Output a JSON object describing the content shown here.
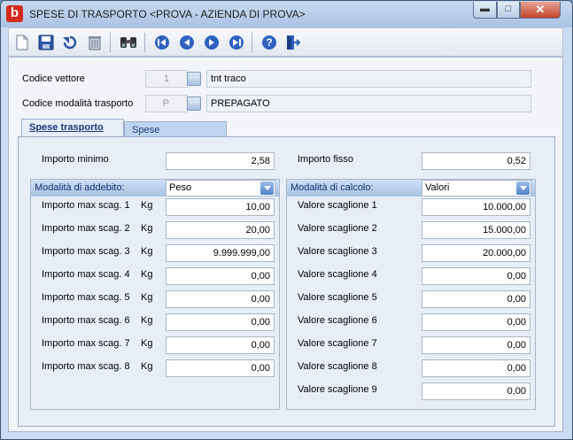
{
  "window": {
    "title": "SPESE DI TRASPORTO <PROVA - AZIENDA DI PROVA>",
    "app_icon_letter": "b",
    "min_glyph": "▬",
    "max_glyph": "□",
    "close_glyph": "✕"
  },
  "toolbar": {
    "buttons": [
      "new-document-icon",
      "save-icon",
      "undo-icon",
      "delete-icon",
      "find-icon",
      "first-record-icon",
      "previous-record-icon",
      "next-record-icon",
      "last-record-icon",
      "help-icon",
      "exit-icon"
    ]
  },
  "header": {
    "vettore_label": "Codice vettore",
    "vettore_code": "1",
    "vettore_desc": "tnt traco",
    "modalita_label": "Codice modalità trasporto",
    "modalita_code": "P",
    "modalita_desc": "PREPAGATO",
    "lookup_glyph": "···"
  },
  "tabs": [
    {
      "label": "Spese trasporto",
      "active": true
    },
    {
      "label": "Spese contrassegno",
      "active": false
    }
  ],
  "left": {
    "importo_minimo_label": "Importo minimo",
    "importo_minimo_value": "2,58",
    "group_label": "Modalità di addebito:",
    "combo_value": "Peso",
    "unit": "Kg",
    "rows": [
      {
        "label": "Importo max scag. 1",
        "value": "10,00"
      },
      {
        "label": "Importo max scag. 2",
        "value": "20,00"
      },
      {
        "label": "Importo max scag. 3",
        "value": "9.999.999,00"
      },
      {
        "label": "Importo max scag. 4",
        "value": "0,00"
      },
      {
        "label": "Importo max scag. 5",
        "value": "0,00"
      },
      {
        "label": "Importo max scag. 6",
        "value": "0,00"
      },
      {
        "label": "Importo max scag. 7",
        "value": "0,00"
      },
      {
        "label": "Importo max scag. 8",
        "value": "0,00"
      }
    ]
  },
  "right": {
    "importo_fisso_label": "Importo fisso",
    "importo_fisso_value": "0,52",
    "group_label": "Modalità di calcolo:",
    "combo_value": "Valori",
    "rows": [
      {
        "label": "Valore scaglione 1",
        "value": "10.000,00"
      },
      {
        "label": "Valore scaglione 2",
        "value": "15.000,00"
      },
      {
        "label": "Valore scaglione 3",
        "value": "20.000,00"
      },
      {
        "label": "Valore scaglione 4",
        "value": "0,00"
      },
      {
        "label": "Valore scaglione 5",
        "value": "0,00"
      },
      {
        "label": "Valore scaglione 6",
        "value": "0,00"
      },
      {
        "label": "Valore scaglione 7",
        "value": "0,00"
      },
      {
        "label": "Valore scaglione 8",
        "value": "0,00"
      },
      {
        "label": "Valore scaglione 9",
        "value": "0,00"
      }
    ]
  },
  "colors": {
    "accent": "#2a5fb0",
    "close_button": "#c2432c",
    "app_icon": "#d42b1e"
  }
}
